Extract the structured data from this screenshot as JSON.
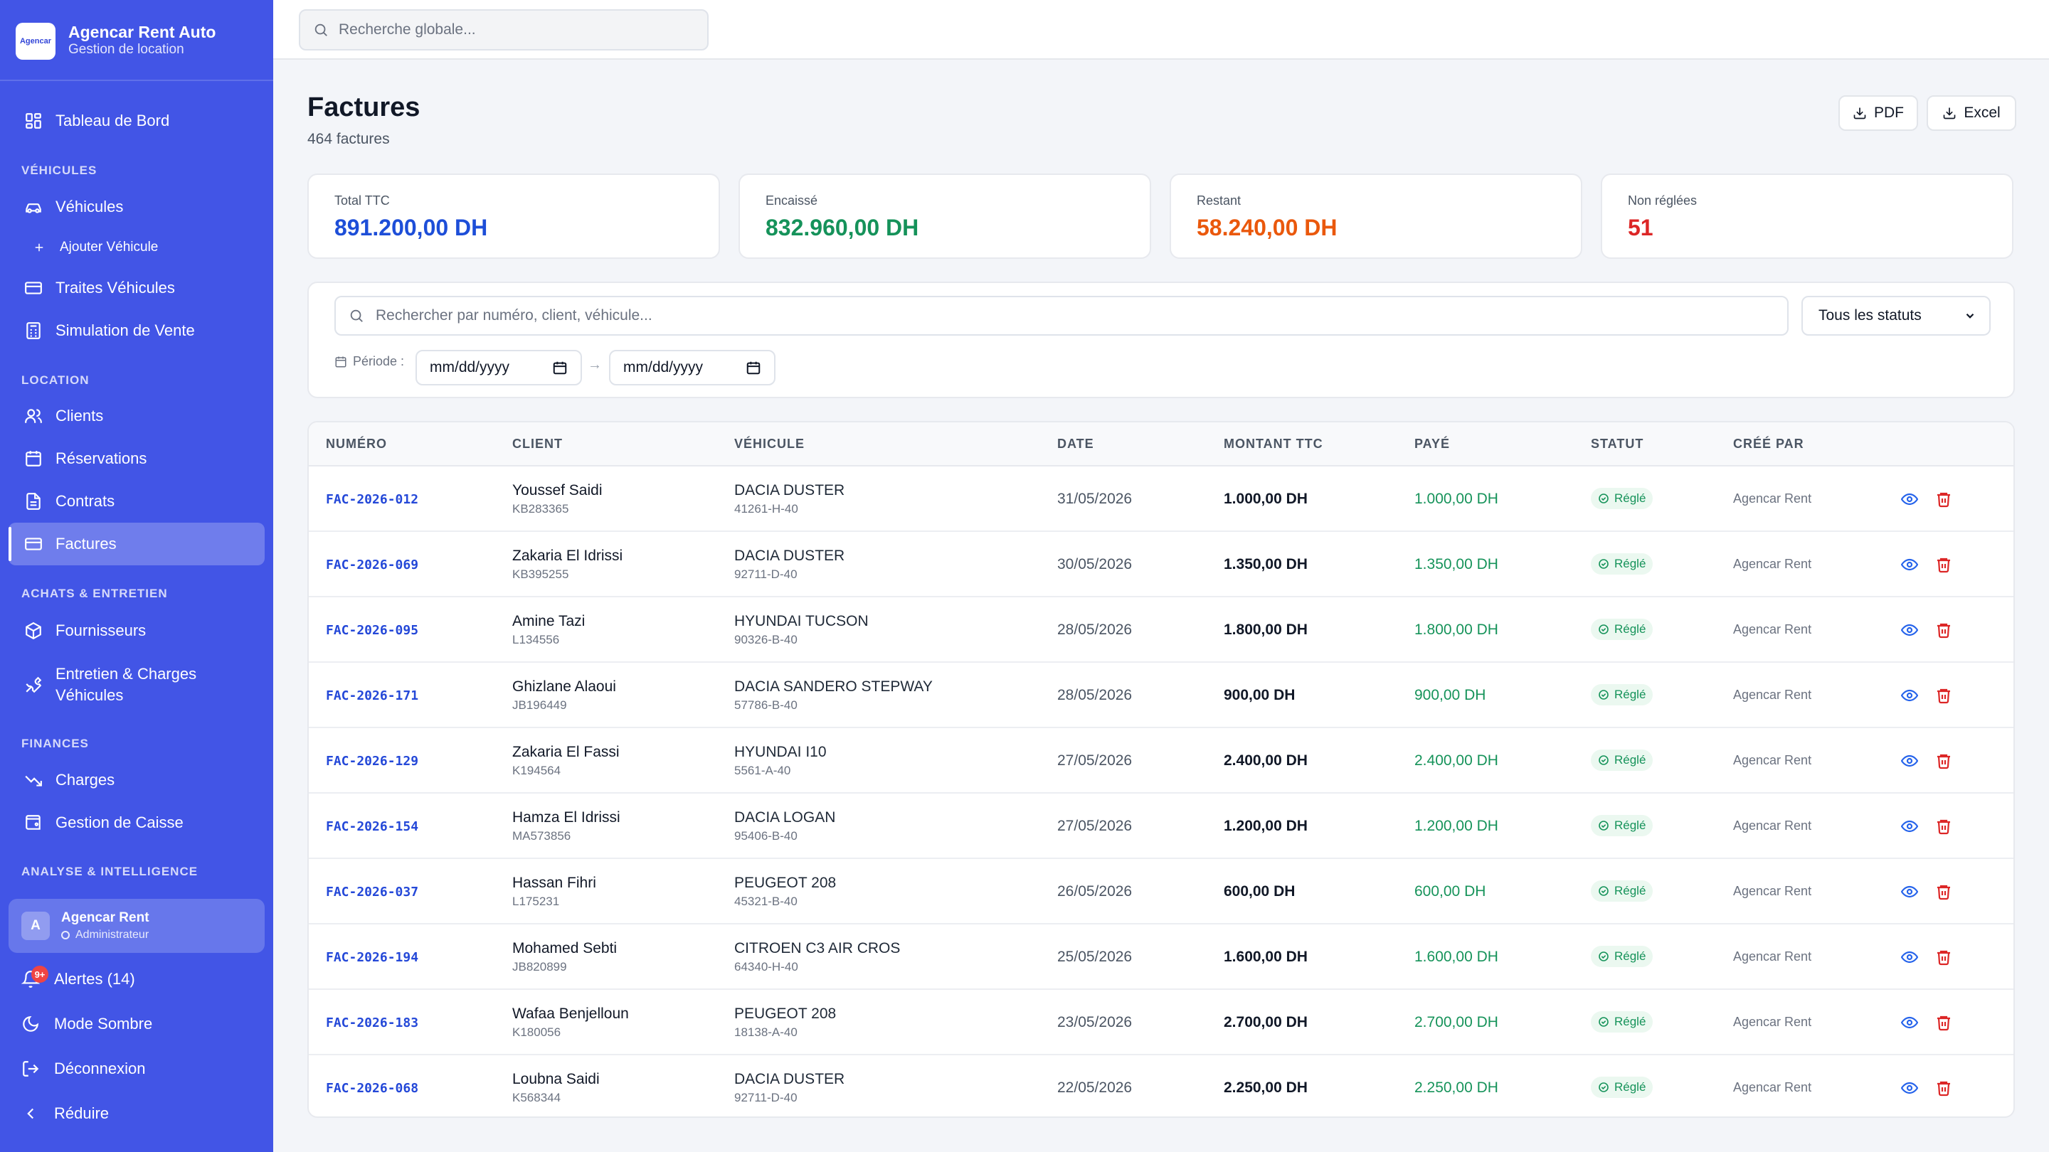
{
  "brand": {
    "logo_text": "Agencar",
    "name": "Agencar Rent Auto",
    "subtitle": "Gestion de location"
  },
  "global_search": {
    "placeholder": "Recherche globale..."
  },
  "sidebar": {
    "dashboard": "Tableau de Bord",
    "sections": {
      "vehicules": "VÉHICULES",
      "location": "LOCATION",
      "achats": "ACHATS & ENTRETIEN",
      "finances": "FINANCES",
      "analyse": "ANALYSE & INTELLIGENCE"
    },
    "items": {
      "vehicules": "Véhicules",
      "ajouter_vehicule": "Ajouter Véhicule",
      "traites": "Traites Véhicules",
      "simulation": "Simulation de Vente",
      "clients": "Clients",
      "reservations": "Réservations",
      "contrats": "Contrats",
      "factures": "Factures",
      "fournisseurs": "Fournisseurs",
      "entretien": "Entretien & Charges Véhicules",
      "charges": "Charges",
      "caisse": "Gestion de Caisse"
    },
    "user": {
      "initial": "A",
      "name": "Agencar Rent",
      "role": "Administrateur"
    },
    "alerts": {
      "label": "Alertes (14)",
      "badge": "9+"
    },
    "dark_mode": "Mode Sombre",
    "logout": "Déconnexion",
    "collapse": "Réduire"
  },
  "page": {
    "title": "Factures",
    "count": "464 factures",
    "export_pdf": "PDF",
    "export_excel": "Excel"
  },
  "kpis": [
    {
      "label": "Total TTC",
      "value": "891.200,00 DH",
      "color": "#1d4ed8"
    },
    {
      "label": "Encaissé",
      "value": "832.960,00 DH",
      "color": "#15925a"
    },
    {
      "label": "Restant",
      "value": "58.240,00 DH",
      "color": "#ea580c"
    },
    {
      "label": "Non réglées",
      "value": "51",
      "color": "#dc2626"
    }
  ],
  "filters": {
    "search_placeholder": "Rechercher par numéro, client, véhicule...",
    "status_selected": "Tous les statuts",
    "period_label": "Période :",
    "date_from": "mm/dd/yyyy",
    "date_to": "mm/dd/yyyy",
    "separator": "→"
  },
  "table": {
    "headers": {
      "numero": "NUMÉRO",
      "client": "CLIENT",
      "vehicule": "VÉHICULE",
      "date": "DATE",
      "montant": "MONTANT TTC",
      "paye": "PAYÉ",
      "statut": "STATUT",
      "cree_par": "CRÉÉ PAR"
    },
    "rows": [
      {
        "numero": "FAC-2026-012",
        "client": "Youssef Saidi",
        "client_id": "KB283365",
        "vehicule": "DACIA DUSTER",
        "plaque": "41261-H-40",
        "date": "31/05/2026",
        "montant": "1.000,00 DH",
        "paye": "1.000,00 DH",
        "statut": "Réglé",
        "cree_par": "Agencar Rent"
      },
      {
        "numero": "FAC-2026-069",
        "client": "Zakaria El Idrissi",
        "client_id": "KB395255",
        "vehicule": "DACIA DUSTER",
        "plaque": "92711-D-40",
        "date": "30/05/2026",
        "montant": "1.350,00 DH",
        "paye": "1.350,00 DH",
        "statut": "Réglé",
        "cree_par": "Agencar Rent"
      },
      {
        "numero": "FAC-2026-095",
        "client": "Amine Tazi",
        "client_id": "L134556",
        "vehicule": "HYUNDAI TUCSON",
        "plaque": "90326-B-40",
        "date": "28/05/2026",
        "montant": "1.800,00 DH",
        "paye": "1.800,00 DH",
        "statut": "Réglé",
        "cree_par": "Agencar Rent"
      },
      {
        "numero": "FAC-2026-171",
        "client": "Ghizlane Alaoui",
        "client_id": "JB196449",
        "vehicule": "DACIA SANDERO STEPWAY",
        "plaque": "57786-B-40",
        "date": "28/05/2026",
        "montant": "900,00 DH",
        "paye": "900,00 DH",
        "statut": "Réglé",
        "cree_par": "Agencar Rent"
      },
      {
        "numero": "FAC-2026-129",
        "client": "Zakaria El Fassi",
        "client_id": "K194564",
        "vehicule": "HYUNDAI I10",
        "plaque": "5561-A-40",
        "date": "27/05/2026",
        "montant": "2.400,00 DH",
        "paye": "2.400,00 DH",
        "statut": "Réglé",
        "cree_par": "Agencar Rent"
      },
      {
        "numero": "FAC-2026-154",
        "client": "Hamza El Idrissi",
        "client_id": "MA573856",
        "vehicule": "DACIA LOGAN",
        "plaque": "95406-B-40",
        "date": "27/05/2026",
        "montant": "1.200,00 DH",
        "paye": "1.200,00 DH",
        "statut": "Réglé",
        "cree_par": "Agencar Rent"
      },
      {
        "numero": "FAC-2026-037",
        "client": "Hassan Fihri",
        "client_id": "L175231",
        "vehicule": "PEUGEOT 208",
        "plaque": "45321-B-40",
        "date": "26/05/2026",
        "montant": "600,00 DH",
        "paye": "600,00 DH",
        "statut": "Réglé",
        "cree_par": "Agencar Rent"
      },
      {
        "numero": "FAC-2026-194",
        "client": "Mohamed Sebti",
        "client_id": "JB820899",
        "vehicule": "CITROEN C3 AIR CROS",
        "plaque": "64340-H-40",
        "date": "25/05/2026",
        "montant": "1.600,00 DH",
        "paye": "1.600,00 DH",
        "statut": "Réglé",
        "cree_par": "Agencar Rent"
      },
      {
        "numero": "FAC-2026-183",
        "client": "Wafaa Benjelloun",
        "client_id": "K180056",
        "vehicule": "PEUGEOT 208",
        "plaque": "18138-A-40",
        "date": "23/05/2026",
        "montant": "2.700,00 DH",
        "paye": "2.700,00 DH",
        "statut": "Réglé",
        "cree_par": "Agencar Rent"
      },
      {
        "numero": "FAC-2026-068",
        "client": "Loubna Saidi",
        "client_id": "K568344",
        "vehicule": "DACIA DUSTER",
        "plaque": "92711-D-40",
        "date": "22/05/2026",
        "montant": "2.250,00 DH",
        "paye": "2.250,00 DH",
        "statut": "Réglé",
        "cree_par": "Agencar Rent"
      }
    ]
  },
  "colors": {
    "sidebar": "#4255e6",
    "link_blue": "#2448d8",
    "paid_green": "#16935a",
    "delete_red": "#dc2626",
    "view_blue": "#2563eb"
  }
}
